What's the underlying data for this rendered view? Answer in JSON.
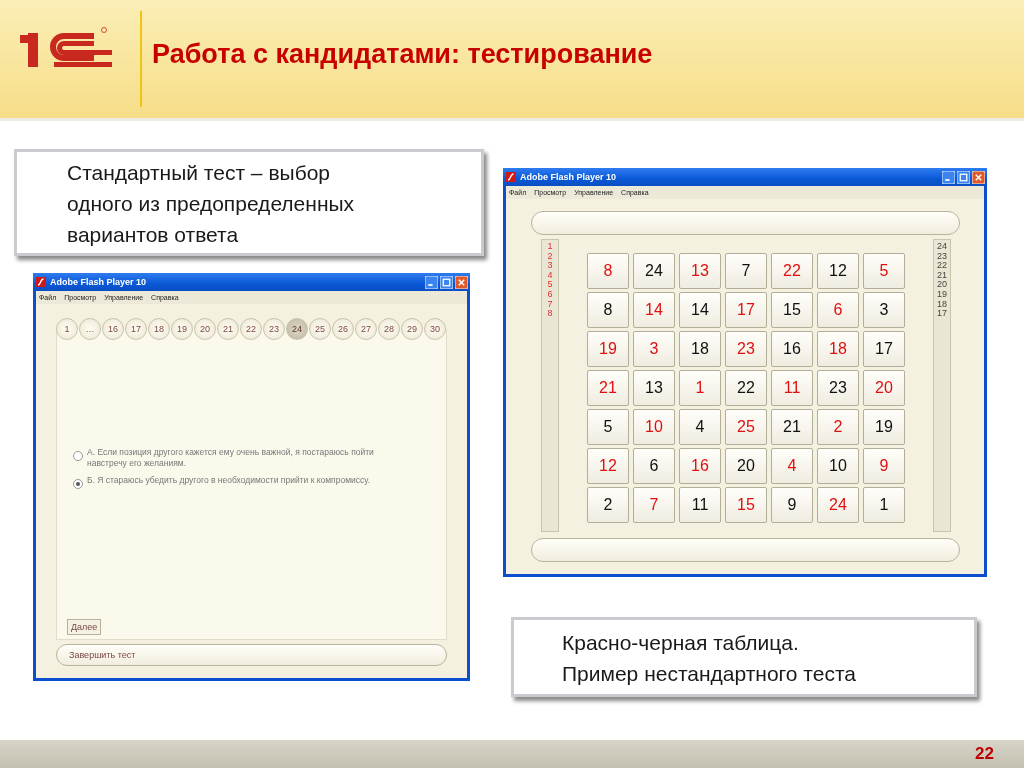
{
  "slide_title": "Работа с кандидатами: тестирование",
  "callout_1": {
    "lines": [
      "Стандартный тест – выбор",
      "одного из предопределенных",
      "вариантов ответа"
    ]
  },
  "window_1": {
    "title": "Adobe Flash Player 10",
    "menu": [
      "Файл",
      "Просмотр",
      "Управление",
      "Справка"
    ],
    "pages": [
      {
        "label": "1",
        "selected": false
      },
      {
        "label": "…",
        "selected": false
      },
      {
        "label": "16",
        "selected": false
      },
      {
        "label": "17",
        "selected": false
      },
      {
        "label": "18",
        "selected": false
      },
      {
        "label": "19",
        "selected": false
      },
      {
        "label": "20",
        "selected": false
      },
      {
        "label": "21",
        "selected": false
      },
      {
        "label": "22",
        "selected": false
      },
      {
        "label": "23",
        "selected": false
      },
      {
        "label": "24",
        "selected": true
      },
      {
        "label": "25",
        "selected": false
      },
      {
        "label": "26",
        "selected": false
      },
      {
        "label": "27",
        "selected": false
      },
      {
        "label": "28",
        "selected": false
      },
      {
        "label": "29",
        "selected": false
      },
      {
        "label": "30",
        "selected": false
      }
    ],
    "options": [
      {
        "lines": [
          "А. Если позиция другого кажется ему очень важной, я постараюсь пойти",
          "навстречу его желаниям."
        ],
        "selected": false
      },
      {
        "lines": [
          "Б. Я стараюсь убедить другого в необходимости прийти к компромиссу."
        ],
        "selected": true
      }
    ],
    "next_button": "Далее",
    "finish_bar": "Завершить тест"
  },
  "window_2": {
    "title": "Adobe Flash Player 10",
    "menu": [
      "Файл",
      "Просмотр",
      "Управление",
      "Справка"
    ],
    "left_list": [
      "1",
      "2",
      "3",
      "4",
      "5",
      "6",
      "7",
      "8"
    ],
    "right_list": [
      "24",
      "23",
      "22",
      "21",
      "20",
      "19",
      "18",
      "17"
    ],
    "grid": [
      [
        {
          "text": "8",
          "color": "#e01010"
        },
        {
          "text": "24",
          "color": "#111111"
        },
        {
          "text": "13",
          "color": "#e01010"
        },
        {
          "text": "7",
          "color": "#111111"
        },
        {
          "text": "22",
          "color": "#e01010"
        },
        {
          "text": "12",
          "color": "#111111"
        },
        {
          "text": "5",
          "color": "#e01010"
        }
      ],
      [
        {
          "text": "8",
          "color": "#111111"
        },
        {
          "text": "14",
          "color": "#e01010"
        },
        {
          "text": "14",
          "color": "#111111"
        },
        {
          "text": "17",
          "color": "#e01010"
        },
        {
          "text": "15",
          "color": "#111111"
        },
        {
          "text": "6",
          "color": "#e01010"
        },
        {
          "text": "3",
          "color": "#111111"
        }
      ],
      [
        {
          "text": "19",
          "color": "#e01010"
        },
        {
          "text": "3",
          "color": "#e01010"
        },
        {
          "text": "18",
          "color": "#111111"
        },
        {
          "text": "23",
          "color": "#e01010"
        },
        {
          "text": "16",
          "color": "#111111"
        },
        {
          "text": "18",
          "color": "#e01010"
        },
        {
          "text": "17",
          "color": "#111111"
        }
      ],
      [
        {
          "text": "21",
          "color": "#e01010"
        },
        {
          "text": "13",
          "color": "#111111"
        },
        {
          "text": "1",
          "color": "#e01010"
        },
        {
          "text": "22",
          "color": "#111111"
        },
        {
          "text": "11",
          "color": "#e01010"
        },
        {
          "text": "23",
          "color": "#111111"
        },
        {
          "text": "20",
          "color": "#e01010"
        }
      ],
      [
        {
          "text": "5",
          "color": "#111111"
        },
        {
          "text": "10",
          "color": "#e01010"
        },
        {
          "text": "4",
          "color": "#111111"
        },
        {
          "text": "25",
          "color": "#e01010"
        },
        {
          "text": "21",
          "color": "#111111"
        },
        {
          "text": "2",
          "color": "#e01010"
        },
        {
          "text": "19",
          "color": "#111111"
        }
      ],
      [
        {
          "text": "12",
          "color": "#e01010"
        },
        {
          "text": "6",
          "color": "#111111"
        },
        {
          "text": "16",
          "color": "#e01010"
        },
        {
          "text": "20",
          "color": "#111111"
        },
        {
          "text": "4",
          "color": "#e01010"
        },
        {
          "text": "10",
          "color": "#111111"
        },
        {
          "text": "9",
          "color": "#e01010"
        }
      ],
      [
        {
          "text": "2",
          "color": "#111111"
        },
        {
          "text": "7",
          "color": "#e01010"
        },
        {
          "text": "11",
          "color": "#111111"
        },
        {
          "text": "15",
          "color": "#e01010"
        },
        {
          "text": "9",
          "color": "#111111"
        },
        {
          "text": "24",
          "color": "#e01010"
        },
        {
          "text": "1",
          "color": "#111111"
        }
      ]
    ]
  },
  "callout_2": {
    "lines": [
      "Красно-черная таблица.",
      "Пример нестандартного теста"
    ]
  },
  "page_number": "22"
}
